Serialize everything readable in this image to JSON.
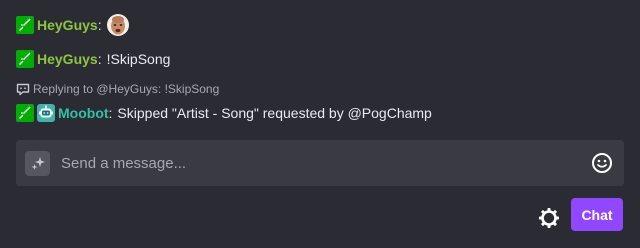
{
  "colors": {
    "background": "#2b2c33",
    "username_heyguys": "#8cc63f",
    "username_moobot": "#2fc0a6",
    "moderator_badge": "#00ad03",
    "bot_badge": "#3fb4a8",
    "chat_button": "#9147ff"
  },
  "messages": [
    {
      "badges": [
        "moderator-sword-icon"
      ],
      "username": "HeyGuys",
      "separator": ":",
      "text": "",
      "emote": "face-emote"
    },
    {
      "badges": [
        "moderator-sword-icon"
      ],
      "username": "HeyGuys",
      "separator": ":",
      "text": "!SkipSong"
    },
    {
      "reply_to": "Replying to @HeyGuys: !SkipSong",
      "badges": [
        "moderator-sword-icon",
        "robot-icon"
      ],
      "username": "Moobot",
      "separator": ":",
      "text": "Skipped \"Artist - Song\" requested by @PogChamp"
    }
  ],
  "input": {
    "placeholder": "Send a message...",
    "value": ""
  },
  "buttons": {
    "chat_label": "Chat"
  },
  "icons": {
    "sparkle": "sparkle-icon",
    "emote_picker": "smiley-icon",
    "settings": "gear-icon",
    "reply": "reply-bubble-icon"
  }
}
